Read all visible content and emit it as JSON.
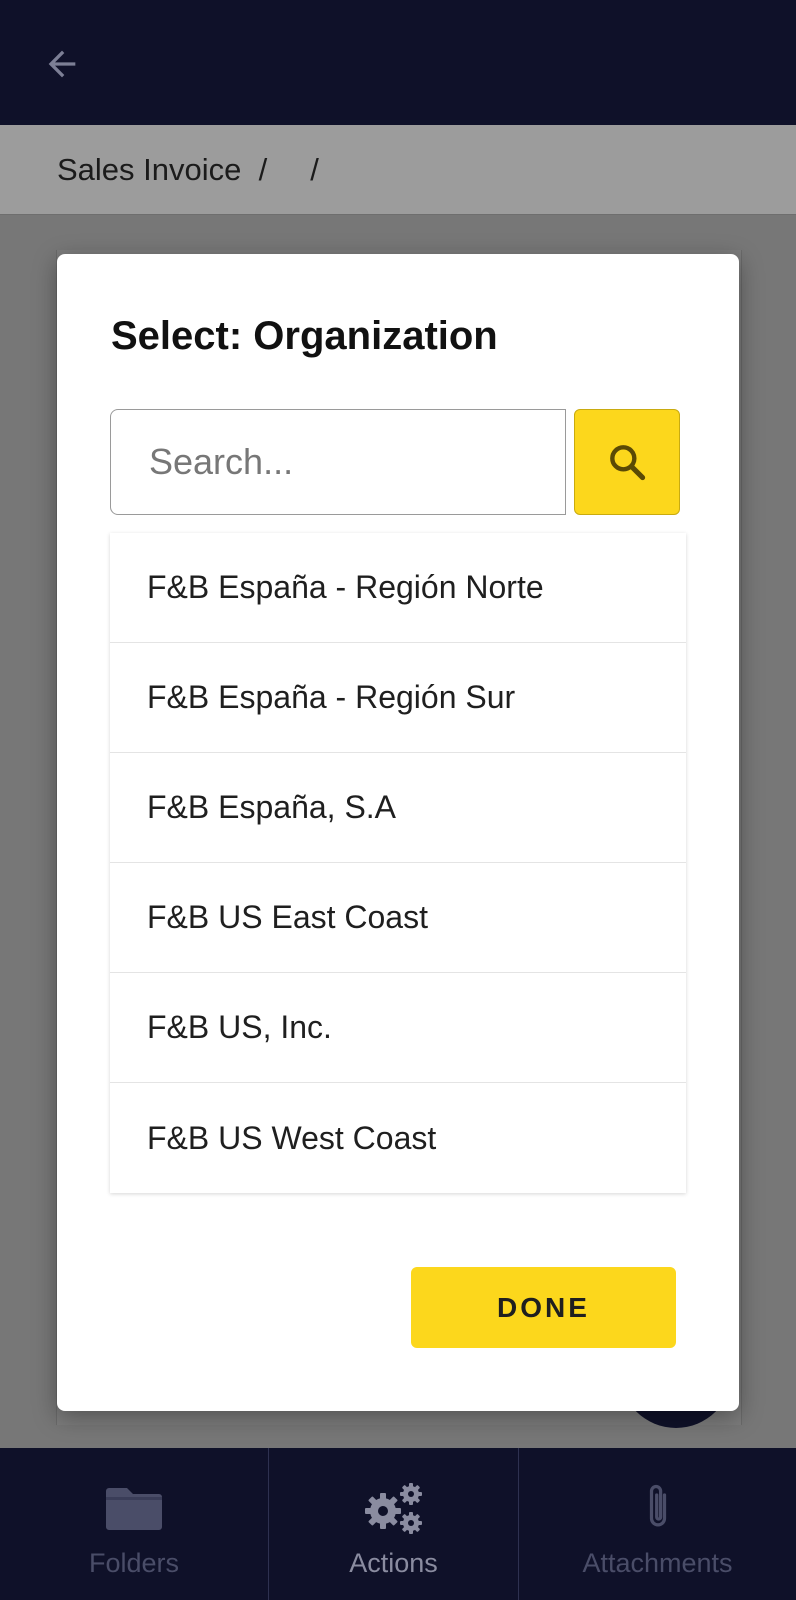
{
  "header": {
    "back_icon": "arrow-left-icon"
  },
  "breadcrumb": {
    "text": "Sales Invoice  /     /"
  },
  "dialog": {
    "title": "Select: Organization",
    "search": {
      "placeholder": "Search...",
      "value": "",
      "button_icon": "search-icon"
    },
    "organizations": [
      "F&B España - Región Norte",
      "F&B España - Región Sur",
      "F&B España, S.A",
      "F&B US East Coast",
      "F&B US, Inc.",
      "F&B US West Coast"
    ],
    "done_label": "DONE"
  },
  "bottom_nav": {
    "tabs": [
      {
        "label": "Folders",
        "icon": "folder-icon"
      },
      {
        "label": "Actions",
        "icon": "gears-icon",
        "active": true
      },
      {
        "label": "Attachments",
        "icon": "paperclip-icon"
      }
    ]
  },
  "colors": {
    "app_bar": "#0f1129",
    "accent_yellow": "#fcd71c",
    "overlay_gray": "#777777"
  }
}
